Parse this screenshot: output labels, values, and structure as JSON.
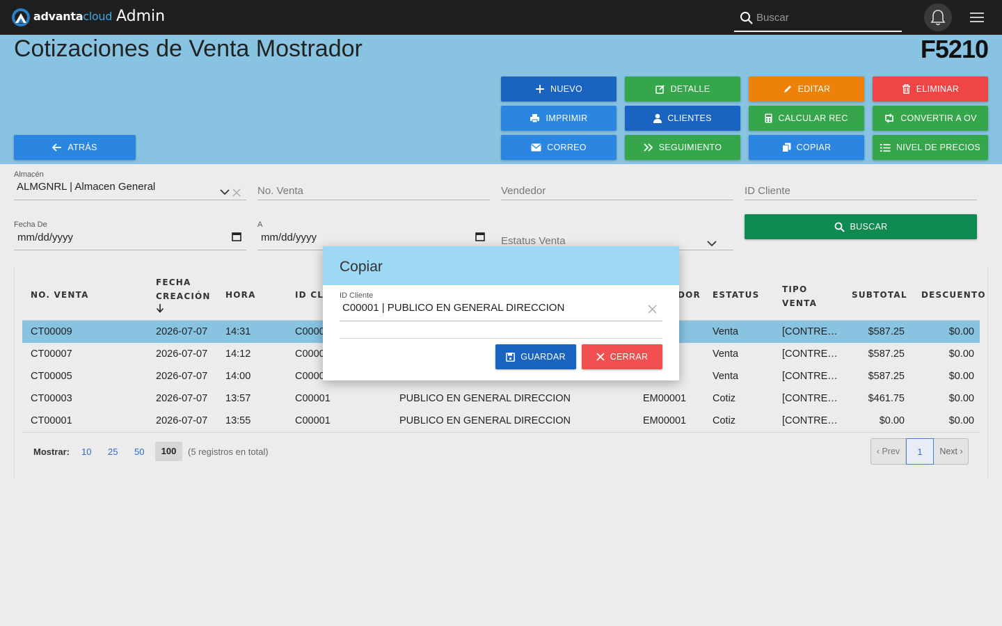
{
  "topbar": {
    "brand_main": "advanta",
    "brand_accent": "cloud",
    "section": "Admin",
    "search_placeholder": "Buscar"
  },
  "header": {
    "title": "Cotizaciones de Venta Mostrador",
    "code": "F5210",
    "back_label": "ATRÁS"
  },
  "actions": {
    "nuevo": "NUEVO",
    "detalle": "DETALLE",
    "editar": "EDITAR",
    "eliminar": "ELIMINAR",
    "imprimir": "IMPRIMIR",
    "clientes": "CLIENTES",
    "calcular": "CALCULAR REC",
    "convertir": "CONVERTIR A OV",
    "correo": "CORREO",
    "seguimiento": "SEGUIMIENTO",
    "copiar": "COPIAR",
    "nivel": "NIVEL DE PRECIOS"
  },
  "filters": {
    "almacen_label": "Almacén",
    "almacen_value": "ALMGNRL | Almacen General",
    "no_venta_placeholder": "No. Venta",
    "vendedor_placeholder": "Vendedor",
    "id_cliente_placeholder": "ID Cliente",
    "fecha_de_label": "Fecha De",
    "fecha_de_value": "mm/dd/yyyy",
    "a_label": "A",
    "a_value": "mm/dd/yyyy",
    "estatus_placeholder": "Estatus Venta",
    "buscar_label": "BUSCAR"
  },
  "table": {
    "headers": {
      "no_venta": "NO. VENTA",
      "fecha_1": "FECHA",
      "fecha_2": "CREACIÓN",
      "hora": "HORA",
      "id_cliente": "ID CLI",
      "vendedor": "DOR",
      "estatus": "ESTATUS",
      "tipo_1": "TIPO",
      "tipo_2": "VENTA",
      "subtotal": "SUBTOTAL",
      "descuento": "DESCUENTO"
    },
    "rows": [
      {
        "no": "CT00009",
        "fecha": "2026-07-07",
        "hora": "14:31",
        "id": "C0000",
        "nombre": "",
        "vend": "1",
        "estatus": "Venta",
        "tipo": "[CONTRE…",
        "subtotal": "$587.25",
        "descuento": "$0.00"
      },
      {
        "no": "CT00007",
        "fecha": "2026-07-07",
        "hora": "14:12",
        "id": "C0000",
        "nombre": "",
        "vend": "1",
        "estatus": "Venta",
        "tipo": "[CONTRE…",
        "subtotal": "$587.25",
        "descuento": "$0.00"
      },
      {
        "no": "CT00005",
        "fecha": "2026-07-07",
        "hora": "14:00",
        "id": "C0000",
        "nombre": "",
        "vend": "1",
        "estatus": "Venta",
        "tipo": "[CONTRE…",
        "subtotal": "$587.25",
        "descuento": "$0.00"
      },
      {
        "no": "CT00003",
        "fecha": "2026-07-07",
        "hora": "13:57",
        "id": "C00001",
        "nombre": "PUBLICO EN GENERAL DIRECCION",
        "vend": "EM00001",
        "estatus": "Cotiz",
        "tipo": "[CONTRE…",
        "subtotal": "$461.75",
        "descuento": "$0.00"
      },
      {
        "no": "CT00001",
        "fecha": "2026-07-07",
        "hora": "13:55",
        "id": "C00001",
        "nombre": "PUBLICO EN GENERAL DIRECCION",
        "vend": "EM00001",
        "estatus": "Cotiz",
        "tipo": "[CONTRE…",
        "subtotal": "$0.00",
        "descuento": "$0.00"
      }
    ]
  },
  "pagination": {
    "mostrar_label": "Mostrar:",
    "sizes": [
      "10",
      "25",
      "50",
      "100"
    ],
    "total_text": "(5 registros en total)",
    "prev": "‹ Prev",
    "page": "1",
    "next": "Next ›"
  },
  "modal": {
    "title": "Copiar",
    "field_label": "ID Cliente",
    "field_value": "C00001 | PUBLICO EN GENERAL DIRECCION",
    "save_label": "GUARDAR",
    "close_label": "CERRAR"
  },
  "colors": {
    "topbar": "#1f1f1f",
    "band": "#88c4e2",
    "blue": "#2a86e0",
    "dark_blue": "#1864c0",
    "green": "#35a74a",
    "orange": "#ee8208",
    "red": "#ef4545",
    "teal": "#0f8b52"
  }
}
